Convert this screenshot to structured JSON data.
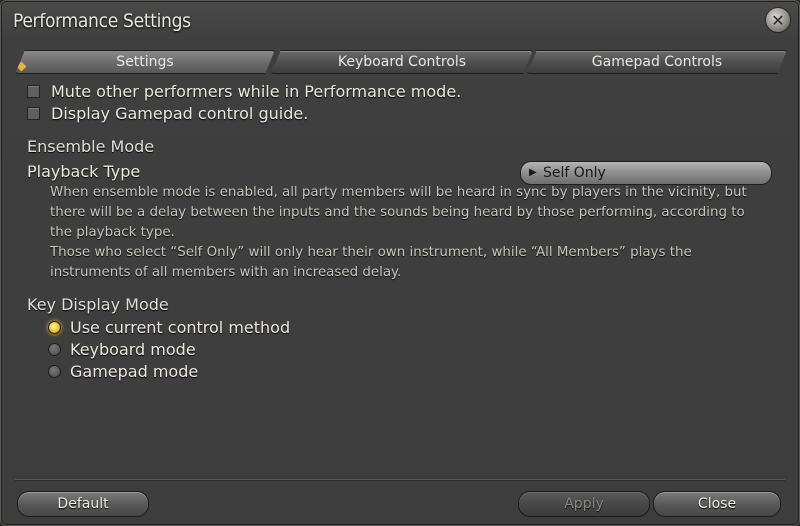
{
  "window": {
    "title": "Performance Settings"
  },
  "tabs": [
    {
      "label": "Settings",
      "active": true
    },
    {
      "label": "Keyboard Controls",
      "active": false
    },
    {
      "label": "Gamepad Controls",
      "active": false
    }
  ],
  "checkboxes": [
    {
      "label": "Mute other performers while in Performance mode.",
      "checked": false
    },
    {
      "label": "Display Gamepad control guide.",
      "checked": false
    }
  ],
  "ensemble": {
    "heading": "Ensemble Mode",
    "playback_label": "Playback Type",
    "playback_value": "Self Only",
    "description_1": "When ensemble mode is enabled, all party members will be heard in sync by players in the vicinity, but there will be a delay between the inputs and the sounds being heard by those performing, according to the playback type.",
    "description_2": "Those who select “Self Only” will only hear their own instrument, while “All Members” plays the instruments of all members with an increased delay."
  },
  "key_display": {
    "heading": "Key Display Mode",
    "options": [
      {
        "label": "Use current control method",
        "selected": true
      },
      {
        "label": "Keyboard mode",
        "selected": false
      },
      {
        "label": "Gamepad mode",
        "selected": false
      }
    ]
  },
  "footer": {
    "default_label": "Default",
    "apply_label": "Apply",
    "close_label": "Close"
  },
  "colors": {
    "accent": "#f0c233",
    "background": "#3d3d3d"
  },
  "icons": {
    "close": "close-icon",
    "dropdown": "triangle-right-icon"
  }
}
